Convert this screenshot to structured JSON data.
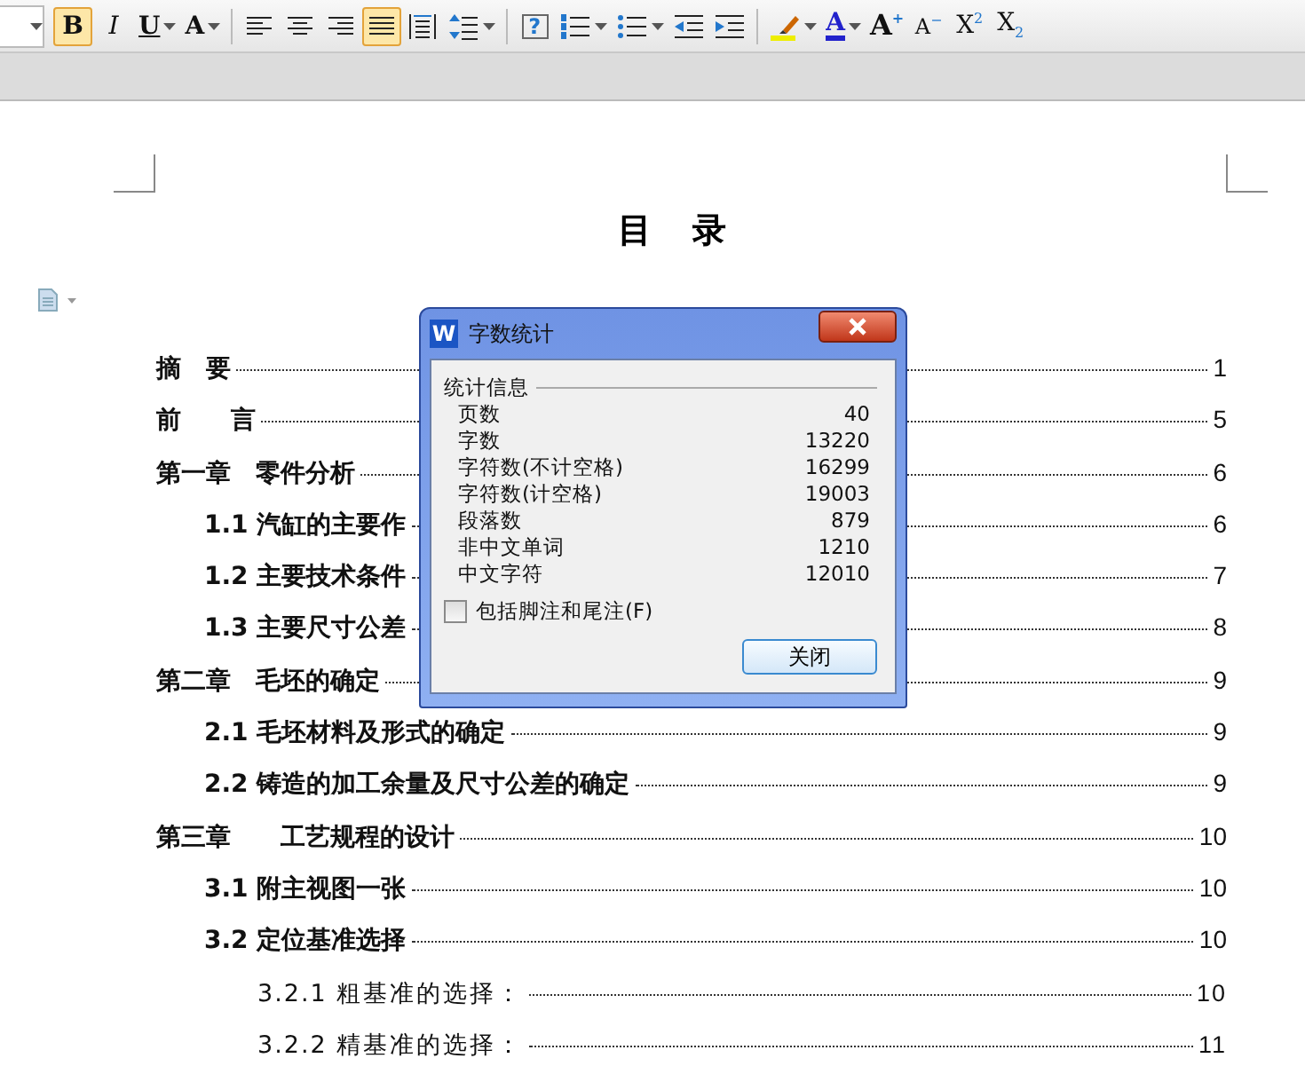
{
  "toolbar": {
    "font_size_field": {
      "has_menu": true
    },
    "items": [
      {
        "kind": "bold",
        "label": "B",
        "selected": true,
        "has_menu": false
      },
      {
        "kind": "italic",
        "label": "I",
        "selected": false,
        "has_menu": false
      },
      {
        "kind": "underline",
        "label": "U",
        "selected": false,
        "has_menu": true
      },
      {
        "kind": "spacing",
        "label": "A",
        "selected": false,
        "has_menu": true
      },
      {
        "kind": "separator"
      },
      {
        "kind": "alignleft",
        "selected": false,
        "has_menu": false
      },
      {
        "kind": "aligncenter",
        "selected": false,
        "has_menu": false
      },
      {
        "kind": "alignright",
        "selected": false,
        "has_menu": false
      },
      {
        "kind": "justify",
        "selected": true,
        "has_menu": false
      },
      {
        "kind": "distribute",
        "selected": false,
        "has_menu": false
      },
      {
        "kind": "linespacing",
        "selected": false,
        "has_menu": true
      },
      {
        "kind": "separator"
      },
      {
        "kind": "help",
        "label": "?",
        "selected": false,
        "has_menu": false
      },
      {
        "kind": "numbered",
        "selected": false,
        "has_menu": true
      },
      {
        "kind": "bullets",
        "selected": false,
        "has_menu": true
      },
      {
        "kind": "outdent",
        "selected": false,
        "has_menu": false
      },
      {
        "kind": "indent",
        "selected": false,
        "has_menu": false
      },
      {
        "kind": "separator"
      },
      {
        "kind": "highlight",
        "selected": false,
        "has_menu": true
      },
      {
        "kind": "fontcolor",
        "label": "A",
        "selected": false,
        "has_menu": true
      },
      {
        "kind": "grow",
        "label": "A$^{+}$",
        "selected": false,
        "has_menu": false
      },
      {
        "kind": "shrink",
        "label": "A$^{−}$",
        "selected": false,
        "has_menu": false
      },
      {
        "kind": "superscript",
        "label": "X$^{2}$",
        "selected": false,
        "has_menu": false
      },
      {
        "kind": "subscript",
        "label": "X$_{2}$",
        "selected": false,
        "has_menu": false
      }
    ]
  },
  "document": {
    "title": "目　录",
    "toc": [
      {
        "text": "摘　要",
        "page": "1"
      },
      {
        "text": "前　　言",
        "page": "5"
      },
      {
        "text": "第一章　零件分析",
        "page": "6",
        "children": [
          {
            "text": "1.1 汽缸的主要作",
            "page": "6"
          },
          {
            "text": "1.2 主要技术条件",
            "page": "7"
          },
          {
            "text": "1.3 主要尺寸公差",
            "page": "8"
          }
        ]
      },
      {
        "text": "第二章　毛坯的确定",
        "page": "9",
        "children": [
          {
            "text": "2.1 毛坯材料及形式的确定",
            "page": "9"
          },
          {
            "text": "2.2 铸造的加工余量及尺寸公差的确定",
            "page": "9"
          }
        ]
      },
      {
        "text": "第三章　　工艺规程的设计",
        "page": "10",
        "children": [
          {
            "text": "3.1 附主视图一张",
            "page": "10"
          },
          {
            "text": "3.2 定位基准选择",
            "page": "10",
            "children": [
              {
                "text": "3.2.1 粗基准的选择：",
                "page": "10"
              },
              {
                "text": "3.2.2 精基准的选择：",
                "page": "11"
              }
            ]
          }
        ]
      }
    ]
  },
  "dialog": {
    "app_icon": "W",
    "title": "字数统计",
    "group": "统计信息",
    "stats": [
      {
        "label": "页数",
        "value": "40"
      },
      {
        "label": "字数",
        "value": "13220"
      },
      {
        "label": "字符数(不计空格)",
        "value": "16299"
      },
      {
        "label": "字符数(计空格)",
        "value": "19003"
      },
      {
        "label": "段落数",
        "value": "879"
      },
      {
        "label": "非中文单词",
        "value": "1210"
      },
      {
        "label": "中文字符",
        "value": "12010"
      }
    ],
    "checkbox": {
      "label": "包括脚注和尾注(F)",
      "checked": false
    },
    "close_button": "关闭"
  }
}
